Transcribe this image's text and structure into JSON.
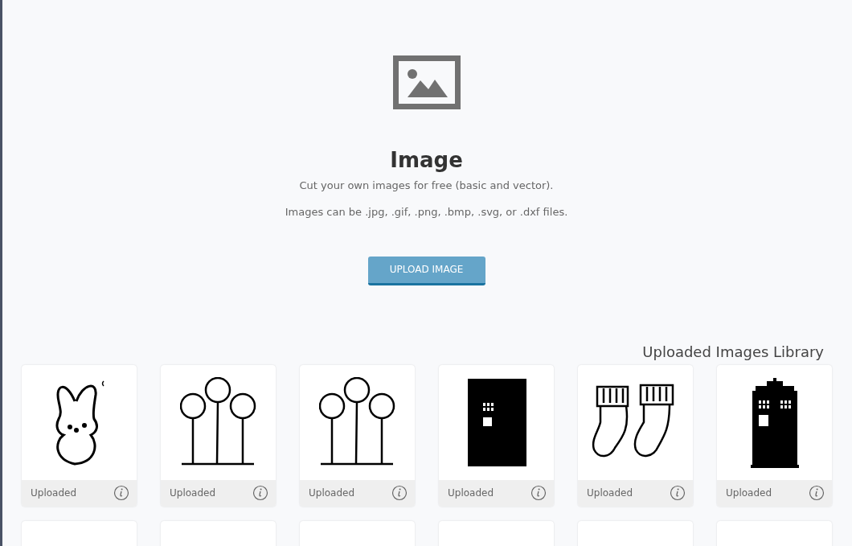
{
  "header": {
    "title": "Image",
    "lines": [
      "Cut your own images for free (basic and vector).",
      "Images can be .jpg, .gif, .png, .bmp, .svg, or .dxf files."
    ],
    "button": "UPLOAD IMAGE"
  },
  "library": {
    "title": "Uploaded Images Library",
    "items": [
      {
        "kind": "bunny",
        "label": "Uploaded"
      },
      {
        "kind": "circles",
        "label": "Uploaded"
      },
      {
        "kind": "circles",
        "label": "Uploaded"
      },
      {
        "kind": "door",
        "label": "Uploaded"
      },
      {
        "kind": "socks",
        "label": "Uploaded"
      },
      {
        "kind": "booth",
        "label": "Uploaded"
      },
      {
        "kind": "blank"
      },
      {
        "kind": "blank"
      },
      {
        "kind": "blank"
      },
      {
        "kind": "blank"
      },
      {
        "kind": "blank"
      },
      {
        "kind": "blank"
      }
    ]
  }
}
